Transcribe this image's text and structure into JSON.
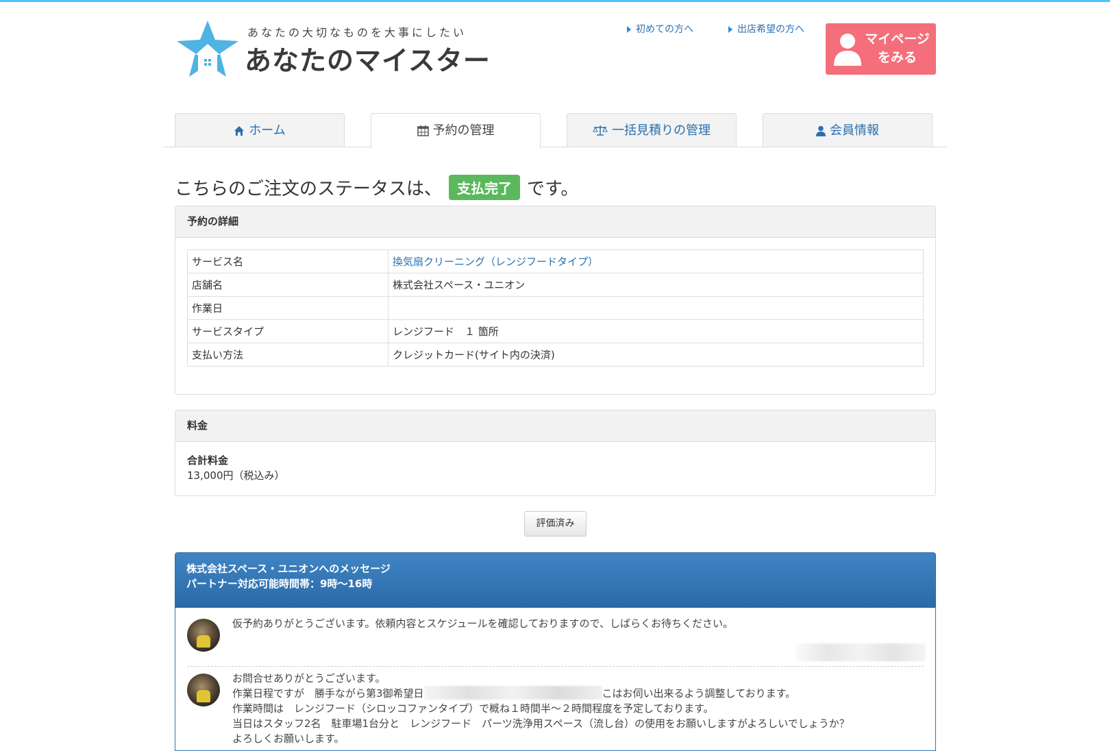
{
  "header": {
    "tagline": "あなたの大切なものを大事にしたい",
    "site_name": "あなたのマイスター",
    "link_first_time": "初めての方へ",
    "link_shop_owner": "出店希望の方へ",
    "mypage_label_line1": "マイページ",
    "mypage_label_line2": "をみる"
  },
  "tabs": [
    {
      "label": "ホーム",
      "icon": "home-icon",
      "active": false
    },
    {
      "label": "予約の管理",
      "icon": "calendar-icon",
      "active": true
    },
    {
      "label": "一括見積りの管理",
      "icon": "scale-icon",
      "active": false
    },
    {
      "label": "会員情報",
      "icon": "user-icon",
      "active": false
    }
  ],
  "status": {
    "prefix": "こちらのご注文のステータスは、",
    "badge": "支払完了",
    "suffix": "です。",
    "badge_color": "#5cb85c"
  },
  "details": {
    "heading": "予約の詳細",
    "rows": [
      {
        "label": "サービス名",
        "value": "換気扇クリーニング（レンジフードタイプ）"
      },
      {
        "label": "店舗名",
        "value": "株式会社スペース・ユニオン"
      },
      {
        "label": "作業日",
        "value": ""
      },
      {
        "label": "サービスタイプ",
        "value": "レンジフード　１ 箇所"
      },
      {
        "label": "支払い方法",
        "value": "クレジットカード(サイト内の決済)"
      }
    ]
  },
  "fee": {
    "heading": "料金",
    "total_label": "合計料金",
    "total_value": "13,000円（税込み）"
  },
  "review_button": "評価済み",
  "messages": {
    "title": "株式会社スペース・ユニオンへのメッセージ",
    "hours": "パートナー対応可能時間帯：9時〜16時",
    "items": [
      {
        "lines": [
          "仮予約ありがとうございます。依頼内容とスケジュールを確認しておりますので、しばらくお待ちください。"
        ]
      },
      {
        "lines": [
          "お問合せありがとうございます。",
          "作業日程ですが　勝手ながら第3御希望日",
          "こはお伺い出来るよう調整しております。",
          "作業時間は　レンジフード（シロッコファンタイプ）で概ね１時間半〜２時間程度を予定しております。",
          "当日はスタッフ2名　駐車場1台分と　レンジフード　パーツ洗浄用スペース（流し台）の使用をお願いしますがよろしいでしょうか？",
          "よろしくお願いします。"
        ]
      }
    ]
  },
  "colors": {
    "accent_blue": "#2a6fb0",
    "mypage_pink": "#f46f7b",
    "message_header": "#2f6ea8"
  }
}
